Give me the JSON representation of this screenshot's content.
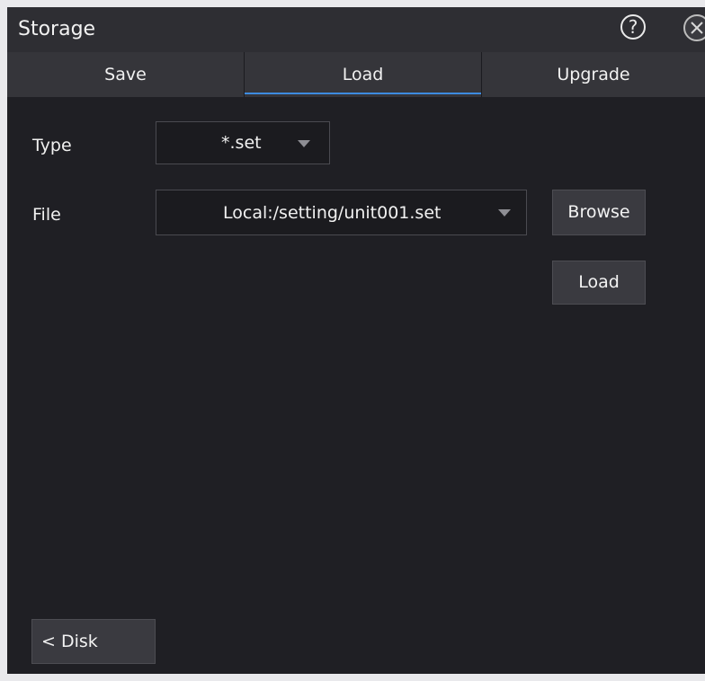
{
  "window": {
    "title": "Storage",
    "help_glyph": "?",
    "close_icon": "close-icon"
  },
  "tabs": [
    {
      "label": "Save",
      "active": false
    },
    {
      "label": "Load",
      "active": true
    },
    {
      "label": "Upgrade",
      "active": false
    }
  ],
  "form": {
    "type_label": "Type",
    "type_value": "*.set",
    "file_label": "File",
    "file_value": "Local:/setting/unit001.set"
  },
  "buttons": {
    "browse": "Browse",
    "load": "Load",
    "disk": "< Disk"
  },
  "colors": {
    "accent": "#3d8be0",
    "panel_bg": "#1f1f24",
    "tab_bg": "#35353a"
  }
}
